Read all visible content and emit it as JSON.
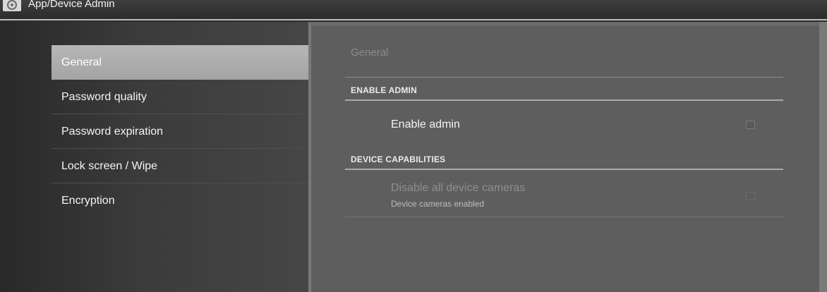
{
  "window": {
    "title": "App/Device Admin",
    "icon": "android-settings-icon"
  },
  "sidebar": {
    "items": [
      {
        "label": "General",
        "selected": true
      },
      {
        "label": "Password quality",
        "selected": false
      },
      {
        "label": "Password expiration",
        "selected": false
      },
      {
        "label": "Lock screen / Wipe",
        "selected": false
      },
      {
        "label": "Encryption",
        "selected": false
      }
    ]
  },
  "main": {
    "breadcrumb": "General",
    "sections": [
      {
        "header": "ENABLE ADMIN",
        "prefs": [
          {
            "title": "Enable admin",
            "summary": "",
            "enabled": true,
            "checked": false
          }
        ]
      },
      {
        "header": "DEVICE CAPABILITIES",
        "prefs": [
          {
            "title": "Disable all device cameras",
            "summary": "Device cameras enabled",
            "enabled": false,
            "checked": false
          }
        ]
      }
    ]
  },
  "colors": {
    "accent_selected": "#b0b0b0",
    "pane_background": "#5e5e5e",
    "sidebar_background": "#3b3b3b"
  }
}
